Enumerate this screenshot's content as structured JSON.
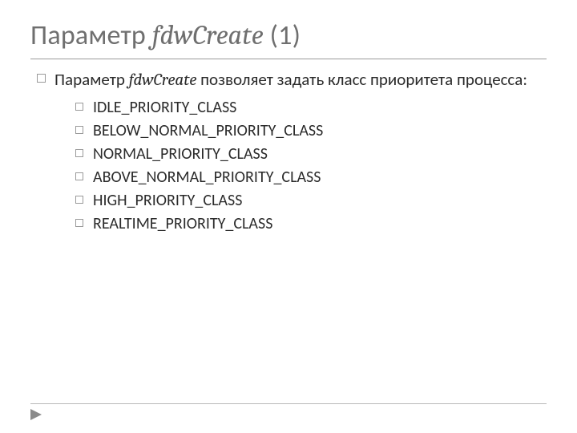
{
  "title": {
    "prefix": "Параметр ",
    "italic": "fdwCreate",
    "suffix": " (1)"
  },
  "intro": {
    "prefix": "Параметр ",
    "italic": "fdwCreate",
    "suffix": " позволяет задать класс приоритета процесса:"
  },
  "items": [
    "IDLE_PRIORITY_CLASS",
    "BELOW_NORMAL_PRIORITY_CLASS",
    "NORMAL_PRIORITY_CLASS",
    "ABOVE_NORMAL_PRIORITY_CLASS",
    "HIGH_PRIORITY_CLASS",
    "REALTIME_PRIORITY_CLASS"
  ]
}
